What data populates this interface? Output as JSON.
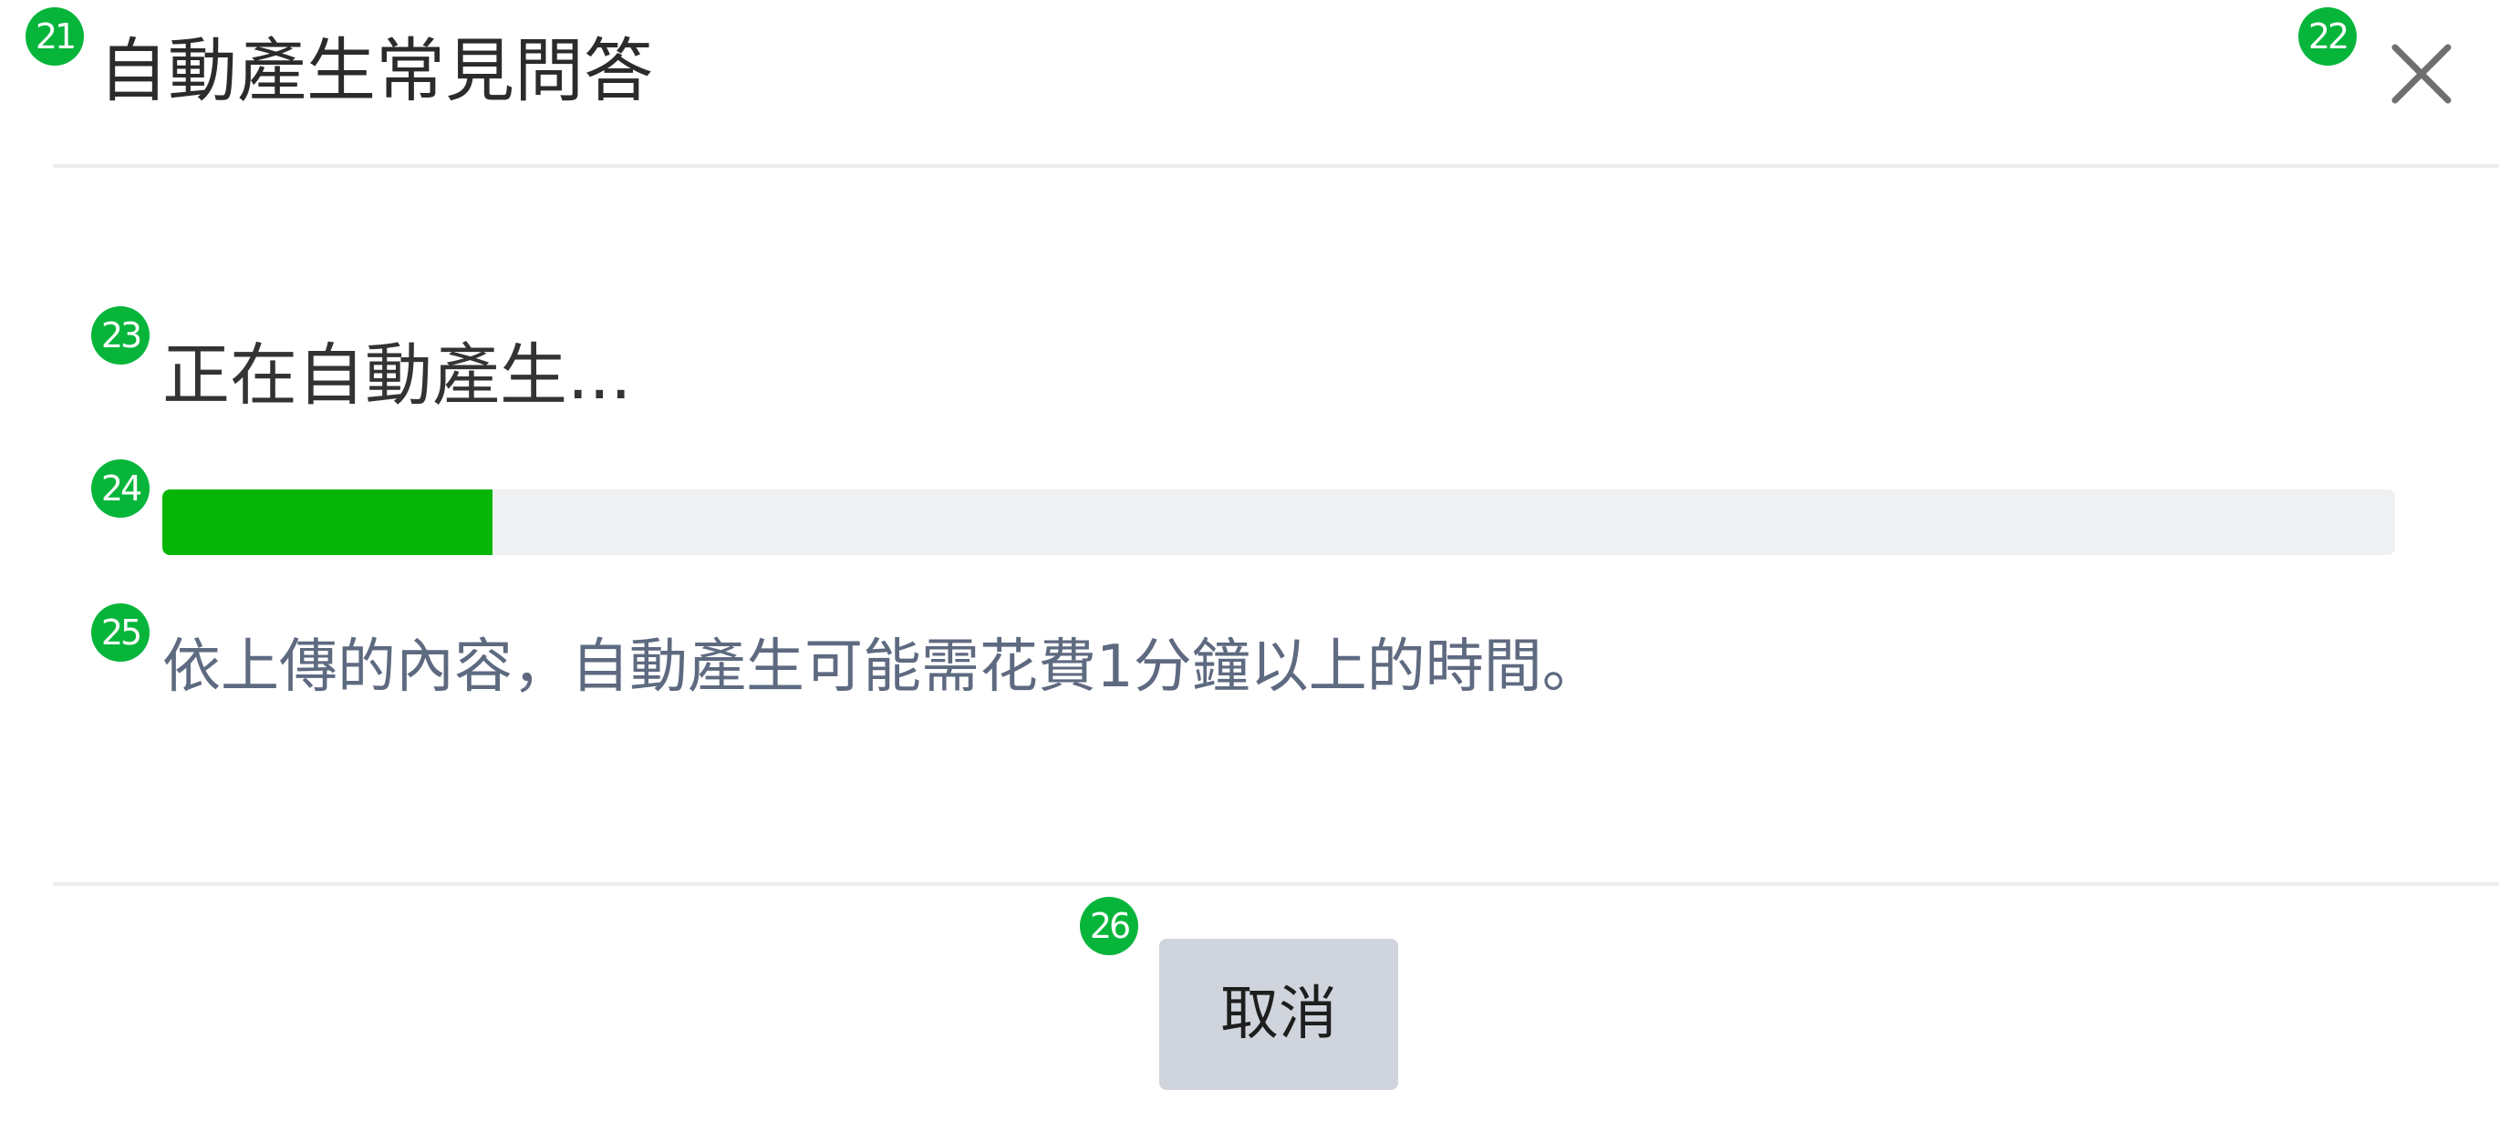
{
  "dialog": {
    "title": "自動產生常見問答",
    "close_icon": "close-icon"
  },
  "progress": {
    "status_text": "正在自動產生...",
    "value_fraction": 0.148,
    "fill_color": "#06b606",
    "track_color": "#eef0f2",
    "info_text": "依上傳的內容，自動產生可能需花費1分鐘以上的時間。"
  },
  "footer": {
    "cancel_label": "取消"
  },
  "markers": {
    "title": "21",
    "close": "22",
    "status": "23",
    "progress_bar": "24",
    "info": "25",
    "cancel": "26",
    "color": "#07b53b"
  }
}
